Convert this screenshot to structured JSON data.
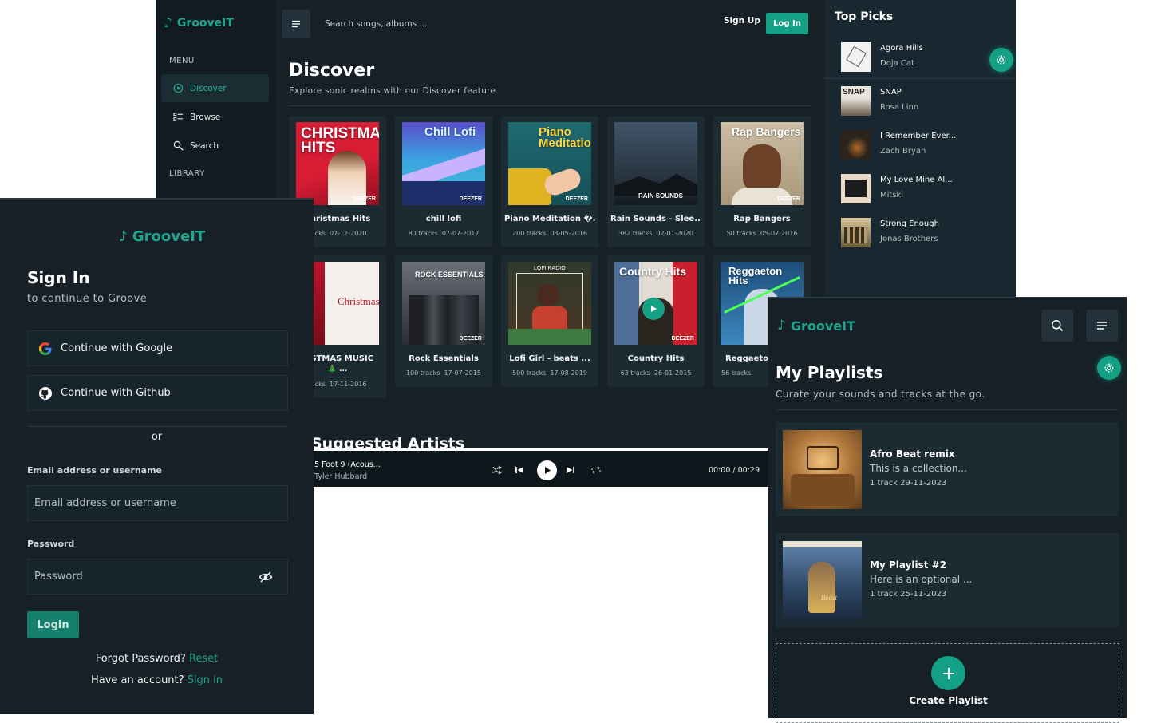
{
  "app": {
    "name": "GrooveIT"
  },
  "sidebar": {
    "menu_heading": "MENU",
    "items": [
      {
        "label": "Discover",
        "icon": "play-circle-icon",
        "active": true
      },
      {
        "label": "Browse",
        "icon": "list-icon",
        "active": false
      },
      {
        "label": "Search",
        "icon": "search-icon",
        "active": false
      }
    ],
    "library_heading": "LIBRARY"
  },
  "header": {
    "search_placeholder": "Search songs, albums ...",
    "signup_label": "Sign Up",
    "login_label": "Log In"
  },
  "discover": {
    "title": "Discover",
    "subtitle": "Explore sonic realms with our Discover feature.",
    "row1": [
      {
        "art_text": "CHRISTMAS HITS",
        "title": "Christmas Hits",
        "tracks": "racks",
        "date": "07-12-2020",
        "bg": "#c8152b",
        "fg": "#ffffff"
      },
      {
        "art_text": "Chill Lofi",
        "title": "chill lofi",
        "tracks": "80 tracks",
        "date": "07-07-2017",
        "bg": "#3b8fd6",
        "fg": "#ffffff"
      },
      {
        "art_text": "Piano Meditation",
        "title": "Piano Meditation �...",
        "tracks": "200 tracks",
        "date": "03-05-2016",
        "bg": "#1d5961",
        "fg": "#ffd23f"
      },
      {
        "art_text": "RAIN SOUNDS",
        "title": "Rain Sounds - Slee...",
        "tracks": "382 tracks",
        "date": "02-01-2020",
        "bg": "#2a3946",
        "fg": "#ffffff"
      },
      {
        "art_text": "Rap Bangers",
        "title": "Rap Bangers",
        "tracks": "50 tracks",
        "date": "05-07-2016",
        "bg": "#b9a98f",
        "fg": "#ffffff"
      }
    ],
    "row2": [
      {
        "art_text": "Christmas",
        "title": "RISTMAS MUSIC",
        "tracks": "racks",
        "date": "17-11-2016",
        "bg": "#f4f1ee",
        "fg": "#c0172c"
      },
      {
        "art_text": "ROCK ESSENTIALS",
        "title": "Rock Essentials",
        "tracks": "100 tracks",
        "date": "17-07-2015",
        "bg": "#3d4047",
        "fg": "#ffffff"
      },
      {
        "art_text": "LOFI RADIO",
        "title": "Lofi Girl - beats ...",
        "tracks": "500 tracks",
        "date": "17-08-2019",
        "bg": "#3a4a34",
        "fg": "#ffffff"
      },
      {
        "art_text": "Country Hits",
        "title": "Country Hits",
        "tracks": "63 tracks",
        "date": "26-01-2015",
        "bg": "#5f7aa0",
        "fg": "#ffffff"
      },
      {
        "art_text": "Reggaeton Hits",
        "title": "Reggaeto",
        "tracks": "56 tracks",
        "date": "",
        "bg": "#2b6f9e",
        "fg": "#ffffff"
      }
    ],
    "row2_extra_line": "🎄 ...",
    "artists_heading": "Suggested Artists"
  },
  "player": {
    "track": "5 Foot 9 (Acous...",
    "artist": "Tyler Hubbard",
    "time": "00:00  /  00:29"
  },
  "top_picks": {
    "title": "Top Picks",
    "items": [
      {
        "name": "Agora Hills",
        "artist": "Doja Cat",
        "bg": "#f2f2f2"
      },
      {
        "name": "SNAP",
        "artist": "Rosa Linn",
        "bg": "#c9c3b8"
      },
      {
        "name": "I Remember Ever...",
        "artist": "Zach Bryan",
        "bg": "#2b231c"
      },
      {
        "name": "My Love Mine Al...",
        "artist": "Mitski",
        "bg": "#e8d9c8"
      },
      {
        "name": "Strong Enough",
        "artist": "Jonas Brothers",
        "bg": "#8a7a52"
      }
    ]
  },
  "signin": {
    "title": "Sign In",
    "subtitle": "to continue to Groove",
    "google_label": "Continue with Google",
    "github_label": "Continue with Github",
    "or_text": "or",
    "email_label": "Email address or username",
    "email_placeholder": "Email address or username",
    "password_label": "Password",
    "password_placeholder": "Password",
    "login_label": "Login",
    "forgot_text": "Forgot Password?",
    "reset_link": "Reset",
    "have_account_text": "Have an account?",
    "signin_link": "Sign in"
  },
  "playlists": {
    "title": "My Playlists",
    "subtitle": "Curate your sounds and tracks at the go.",
    "items": [
      {
        "name": "Afro Beat remix",
        "description": "This is a collection...",
        "meta": "1 track  29-11-2023",
        "bg": "#b0773a"
      },
      {
        "name": "My Playlist #2",
        "description": "Here is an optional ...",
        "meta": "1 track  25-11-2023",
        "bg": "#3c5c82"
      }
    ],
    "create_label": "Create Playlist"
  },
  "colors": {
    "accent": "#14a085",
    "background": "#162026",
    "sidebar": "#111b21",
    "card": "#1c2a32"
  }
}
